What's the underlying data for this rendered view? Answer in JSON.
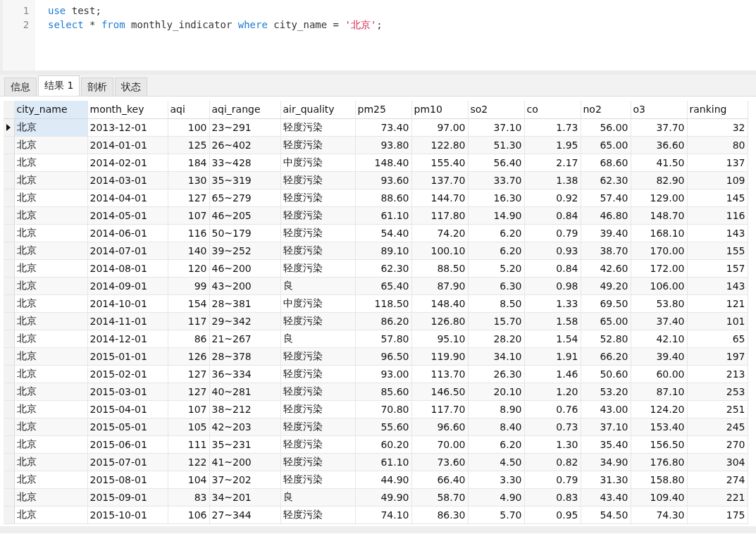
{
  "editor": {
    "lines": [
      {
        "number": "1",
        "tokens": [
          {
            "kind": "keyword",
            "text": "use"
          },
          {
            "kind": "plain",
            "text": " test;"
          }
        ]
      },
      {
        "number": "2",
        "tokens": [
          {
            "kind": "keyword",
            "text": "select"
          },
          {
            "kind": "plain",
            "text": " * "
          },
          {
            "kind": "keyword",
            "text": "from"
          },
          {
            "kind": "plain",
            "text": " monthly_indicator "
          },
          {
            "kind": "keyword",
            "text": "where"
          },
          {
            "kind": "plain",
            "text": " city_name = "
          },
          {
            "kind": "string",
            "text": "'北京'"
          },
          {
            "kind": "plain",
            "text": ";"
          }
        ]
      }
    ]
  },
  "tabs": [
    {
      "label": "信息",
      "selected": false
    },
    {
      "label": "结果 1",
      "selected": true
    },
    {
      "label": "剖析",
      "selected": false
    },
    {
      "label": "状态",
      "selected": false
    }
  ],
  "table": {
    "columns": [
      {
        "label": "city_name"
      },
      {
        "label": "month_key"
      },
      {
        "label": "aqi"
      },
      {
        "label": "aqi_range"
      },
      {
        "label": "air_quality"
      },
      {
        "label": "pm25"
      },
      {
        "label": "pm10"
      },
      {
        "label": "so2"
      },
      {
        "label": "co"
      },
      {
        "label": "no2"
      },
      {
        "label": "o3"
      },
      {
        "label": "ranking"
      }
    ],
    "rows": [
      {
        "selected": true,
        "cells": [
          "北京",
          "2013-12-01",
          "100",
          "23~291",
          "轻度污染",
          "73.40",
          "97.00",
          "37.10",
          "1.73",
          "56.00",
          "37.70",
          "32"
        ]
      },
      {
        "selected": false,
        "cells": [
          "北京",
          "2014-01-01",
          "125",
          "26~402",
          "轻度污染",
          "93.80",
          "122.80",
          "51.30",
          "1.95",
          "65.00",
          "36.60",
          "80"
        ]
      },
      {
        "selected": false,
        "cells": [
          "北京",
          "2014-02-01",
          "184",
          "33~428",
          "中度污染",
          "148.40",
          "155.40",
          "56.40",
          "2.17",
          "68.60",
          "41.50",
          "137"
        ]
      },
      {
        "selected": false,
        "cells": [
          "北京",
          "2014-03-01",
          "130",
          "35~319",
          "轻度污染",
          "93.60",
          "137.70",
          "33.70",
          "1.38",
          "62.30",
          "82.90",
          "109"
        ]
      },
      {
        "selected": false,
        "cells": [
          "北京",
          "2014-04-01",
          "127",
          "65~279",
          "轻度污染",
          "88.60",
          "144.70",
          "16.30",
          "0.92",
          "57.40",
          "129.00",
          "145"
        ]
      },
      {
        "selected": false,
        "cells": [
          "北京",
          "2014-05-01",
          "107",
          "46~205",
          "轻度污染",
          "61.10",
          "117.80",
          "14.90",
          "0.84",
          "46.80",
          "148.70",
          "116"
        ]
      },
      {
        "selected": false,
        "cells": [
          "北京",
          "2014-06-01",
          "116",
          "50~179",
          "轻度污染",
          "54.40",
          "74.20",
          "6.20",
          "0.79",
          "39.40",
          "168.10",
          "143"
        ]
      },
      {
        "selected": false,
        "cells": [
          "北京",
          "2014-07-01",
          "140",
          "39~252",
          "轻度污染",
          "89.10",
          "100.10",
          "6.20",
          "0.93",
          "38.70",
          "170.00",
          "155"
        ]
      },
      {
        "selected": false,
        "cells": [
          "北京",
          "2014-08-01",
          "120",
          "46~200",
          "轻度污染",
          "62.30",
          "88.50",
          "5.20",
          "0.84",
          "42.60",
          "172.00",
          "157"
        ]
      },
      {
        "selected": false,
        "cells": [
          "北京",
          "2014-09-01",
          "99",
          "43~200",
          "良",
          "65.40",
          "87.90",
          "6.30",
          "0.98",
          "49.20",
          "106.00",
          "143"
        ]
      },
      {
        "selected": false,
        "cells": [
          "北京",
          "2014-10-01",
          "154",
          "28~381",
          "中度污染",
          "118.50",
          "148.40",
          "8.50",
          "1.33",
          "69.50",
          "53.80",
          "121"
        ]
      },
      {
        "selected": false,
        "cells": [
          "北京",
          "2014-11-01",
          "117",
          "29~342",
          "轻度污染",
          "86.20",
          "126.80",
          "15.70",
          "1.58",
          "65.00",
          "37.40",
          "101"
        ]
      },
      {
        "selected": false,
        "cells": [
          "北京",
          "2014-12-01",
          "86",
          "21~267",
          "良",
          "57.80",
          "95.10",
          "28.20",
          "1.54",
          "52.80",
          "42.10",
          "65"
        ]
      },
      {
        "selected": false,
        "cells": [
          "北京",
          "2015-01-01",
          "126",
          "28~378",
          "轻度污染",
          "96.50",
          "119.90",
          "34.10",
          "1.91",
          "66.20",
          "39.40",
          "197"
        ]
      },
      {
        "selected": false,
        "cells": [
          "北京",
          "2015-02-01",
          "127",
          "36~334",
          "轻度污染",
          "93.00",
          "113.70",
          "26.30",
          "1.46",
          "50.60",
          "60.00",
          "213"
        ]
      },
      {
        "selected": false,
        "cells": [
          "北京",
          "2015-03-01",
          "127",
          "40~281",
          "轻度污染",
          "85.60",
          "146.50",
          "20.10",
          "1.20",
          "53.20",
          "87.10",
          "253"
        ]
      },
      {
        "selected": false,
        "cells": [
          "北京",
          "2015-04-01",
          "107",
          "38~212",
          "轻度污染",
          "70.80",
          "117.70",
          "8.90",
          "0.76",
          "43.00",
          "124.20",
          "251"
        ]
      },
      {
        "selected": false,
        "cells": [
          "北京",
          "2015-05-01",
          "105",
          "42~203",
          "轻度污染",
          "55.60",
          "96.60",
          "8.40",
          "0.73",
          "37.10",
          "153.40",
          "245"
        ]
      },
      {
        "selected": false,
        "cells": [
          "北京",
          "2015-06-01",
          "111",
          "35~231",
          "轻度污染",
          "60.20",
          "70.00",
          "6.20",
          "1.30",
          "35.40",
          "156.50",
          "270"
        ]
      },
      {
        "selected": false,
        "cells": [
          "北京",
          "2015-07-01",
          "122",
          "41~200",
          "轻度污染",
          "61.10",
          "73.60",
          "4.50",
          "0.82",
          "34.90",
          "176.80",
          "304"
        ]
      },
      {
        "selected": false,
        "cells": [
          "北京",
          "2015-08-01",
          "104",
          "37~202",
          "轻度污染",
          "44.90",
          "66.40",
          "3.30",
          "0.79",
          "31.30",
          "158.80",
          "274"
        ]
      },
      {
        "selected": false,
        "cells": [
          "北京",
          "2015-09-01",
          "83",
          "34~201",
          "良",
          "49.90",
          "58.70",
          "4.90",
          "0.83",
          "43.40",
          "109.40",
          "221"
        ]
      },
      {
        "selected": false,
        "cells": [
          "北京",
          "2015-10-01",
          "106",
          "27~344",
          "轻度污染",
          "74.10",
          "86.30",
          "5.70",
          "0.95",
          "54.50",
          "74.30",
          "175"
        ]
      }
    ]
  }
}
